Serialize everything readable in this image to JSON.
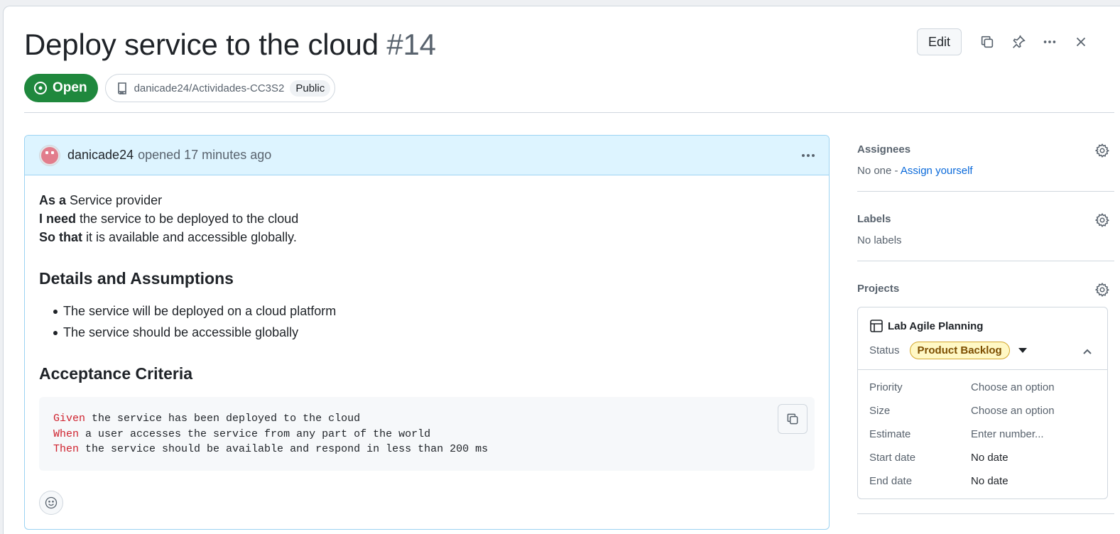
{
  "issue": {
    "title": "Deploy service to the cloud",
    "number": "#14",
    "state": "Open",
    "repo": "danicade24/Actividades-CC3S2",
    "visibility": "Public"
  },
  "header_actions": {
    "edit_label": "Edit"
  },
  "comment": {
    "author": "danicade24",
    "meta": "opened 17 minutes ago",
    "story": [
      {
        "lead": "As a",
        "rest": " Service provider"
      },
      {
        "lead": "I need",
        "rest": " the service to be deployed to the cloud"
      },
      {
        "lead": "So that",
        "rest": " it is available and accessible globally."
      }
    ],
    "details_heading": "Details and Assumptions",
    "details": [
      "The service will be deployed on a cloud platform",
      "The service should be accessible globally"
    ],
    "acceptance_heading": "Acceptance Criteria",
    "gherkin": [
      {
        "kw": "Given",
        "text": " the service has been deployed to the cloud"
      },
      {
        "kw": "When",
        "text": " a user accesses the service from any part of the world"
      },
      {
        "kw": "Then",
        "text": " the service should be available and respond in less than 200 ms"
      }
    ]
  },
  "sidebar": {
    "assignees": {
      "title": "Assignees",
      "text": "No one - ",
      "link": "Assign yourself"
    },
    "labels": {
      "title": "Labels",
      "text": "No labels"
    },
    "projects": {
      "title": "Projects",
      "project_name": "Lab Agile Planning",
      "status_label": "Status",
      "status_value": "Product Backlog",
      "fields": [
        {
          "label": "Priority",
          "value": "Choose an option"
        },
        {
          "label": "Size",
          "value": "Choose an option"
        },
        {
          "label": "Estimate",
          "value": "Enter number..."
        },
        {
          "label": "Start date",
          "value": "No date"
        },
        {
          "label": "End date",
          "value": "No date"
        }
      ]
    }
  },
  "colors": {
    "open_green": "#1f883d",
    "comment_header_bg": "#ddf4ff",
    "keyword_red": "#cf222e",
    "status_yellow_bg": "#fff8c5",
    "link_blue": "#0969da"
  }
}
